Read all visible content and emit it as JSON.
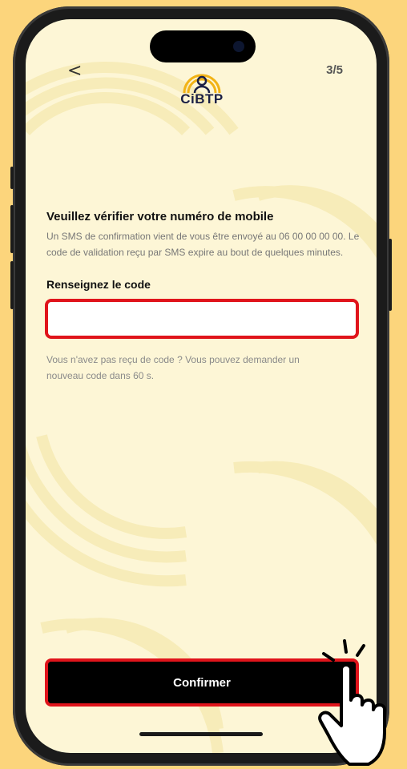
{
  "header": {
    "back_label": "<",
    "step": "3/5",
    "logo_text": "CiBTP"
  },
  "verify": {
    "title": "Veuillez vérifier votre numéro de mobile",
    "description": "Un SMS de confirmation vient de vous être envoyé au 06 00 00 00 00. Le code de validation reçu par SMS expire au bout de quelques minutes.",
    "code_label": "Renseignez le code",
    "code_value": "",
    "resend_text": "Vous n'avez pas reçu de code ? Vous pouvez demander un nouveau code dans 60 s."
  },
  "footer": {
    "confirm_label": "Confirmer"
  },
  "colors": {
    "page_background": "#fcd57c",
    "screen_background": "#fdf6d6",
    "highlight": "#e0141b",
    "logo_arc": "#f2b316",
    "logo_text": "#1a1f45"
  },
  "icons": {
    "pointer": "hand-pointer-icon",
    "logo_person": "person-icon"
  }
}
